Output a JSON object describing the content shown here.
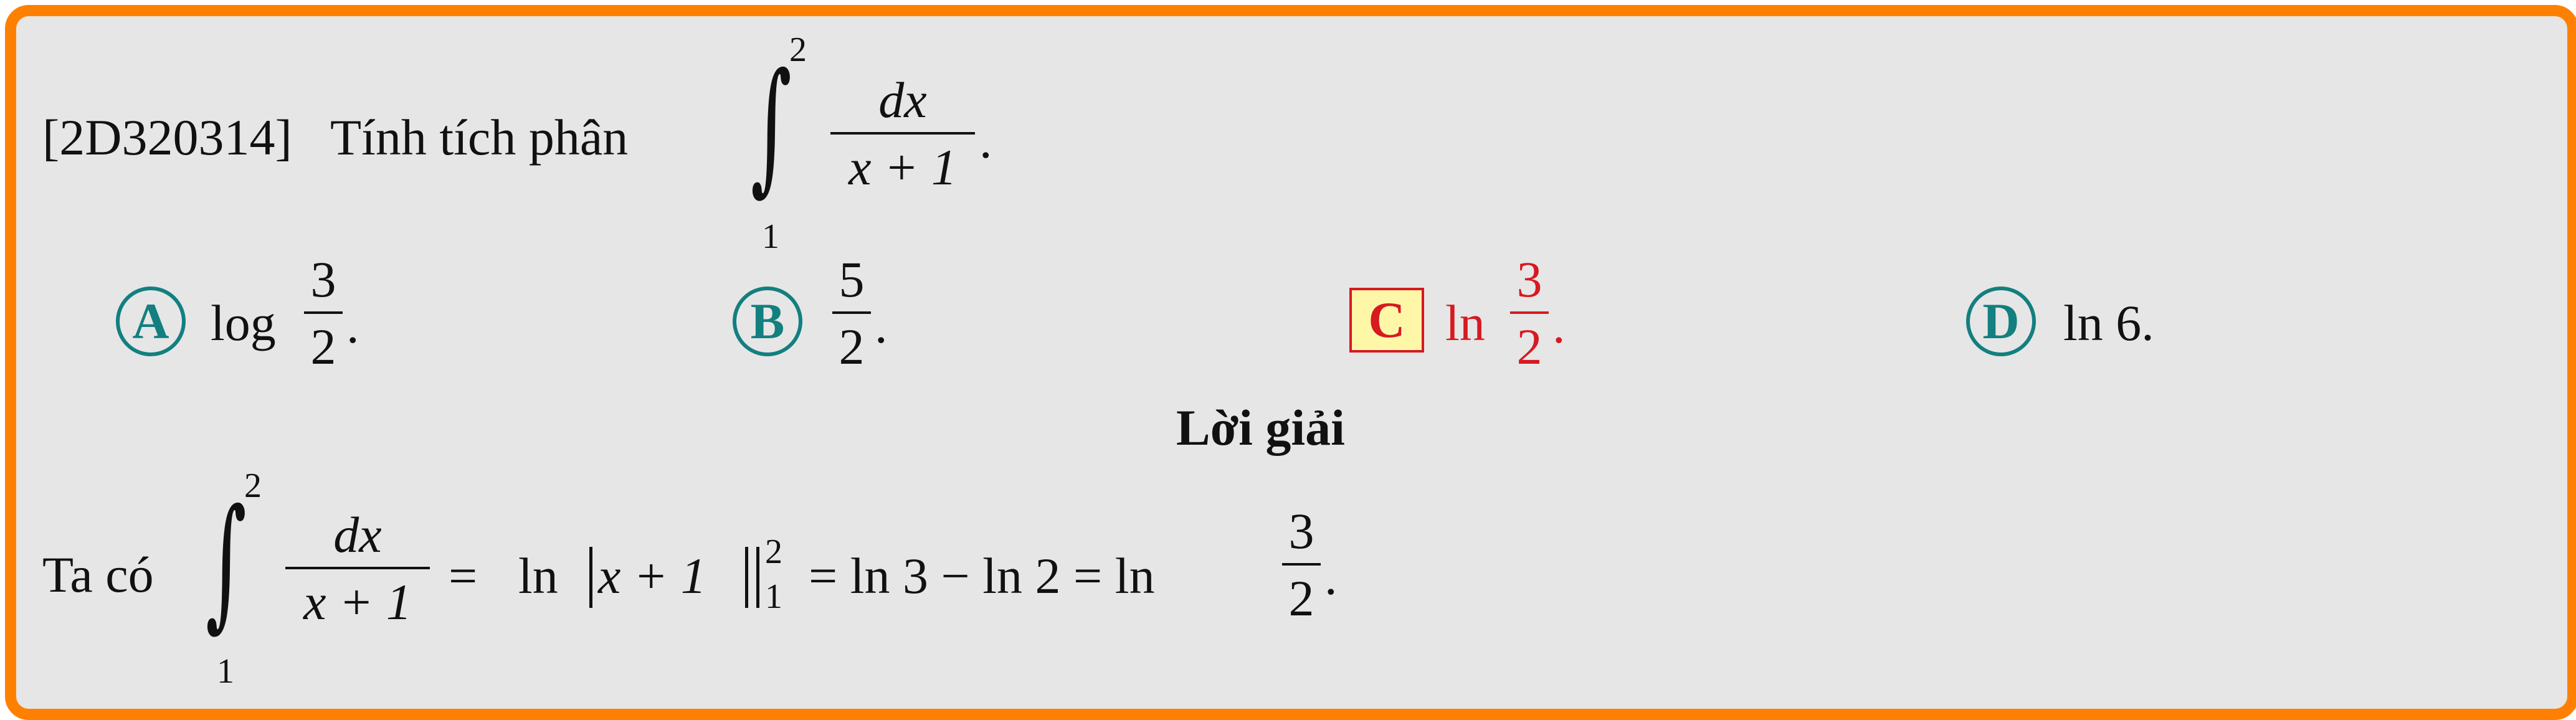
{
  "question": {
    "code": "[2D320314]",
    "prompt": "Tính tích phân",
    "integral": {
      "upper": "2",
      "lower": "1",
      "numerator": "dx",
      "denominator": "x + 1",
      "end": "."
    }
  },
  "options": [
    {
      "letter": "A",
      "func": "log",
      "numerator": "3",
      "denominator": "2",
      "end": "."
    },
    {
      "letter": "B",
      "func": "",
      "numerator": "5",
      "denominator": "2",
      "end": "."
    },
    {
      "letter": "C",
      "func": "ln",
      "numerator": "3",
      "denominator": "2",
      "end": ".",
      "correct": true
    },
    {
      "letter": "D",
      "text": "ln 6."
    }
  ],
  "solution": {
    "heading": "Lời giải",
    "lead": "Ta có",
    "integral": {
      "upper": "2",
      "lower": "1",
      "numerator": "dx",
      "denominator": "x + 1"
    },
    "eq1": "=",
    "ln_text": "ln",
    "abs_inner": "x + 1",
    "eval_upper": "2",
    "eval_lower": "1",
    "middle": "= ln 3 − ln 2 = ln",
    "result_numerator": "3",
    "result_denominator": "2",
    "end": "."
  },
  "colors": {
    "border": "#ff8000",
    "background": "#e6e6e6",
    "option_circle": "#137f7f",
    "correct": "#d71921",
    "correct_fill": "#fff7a8"
  }
}
